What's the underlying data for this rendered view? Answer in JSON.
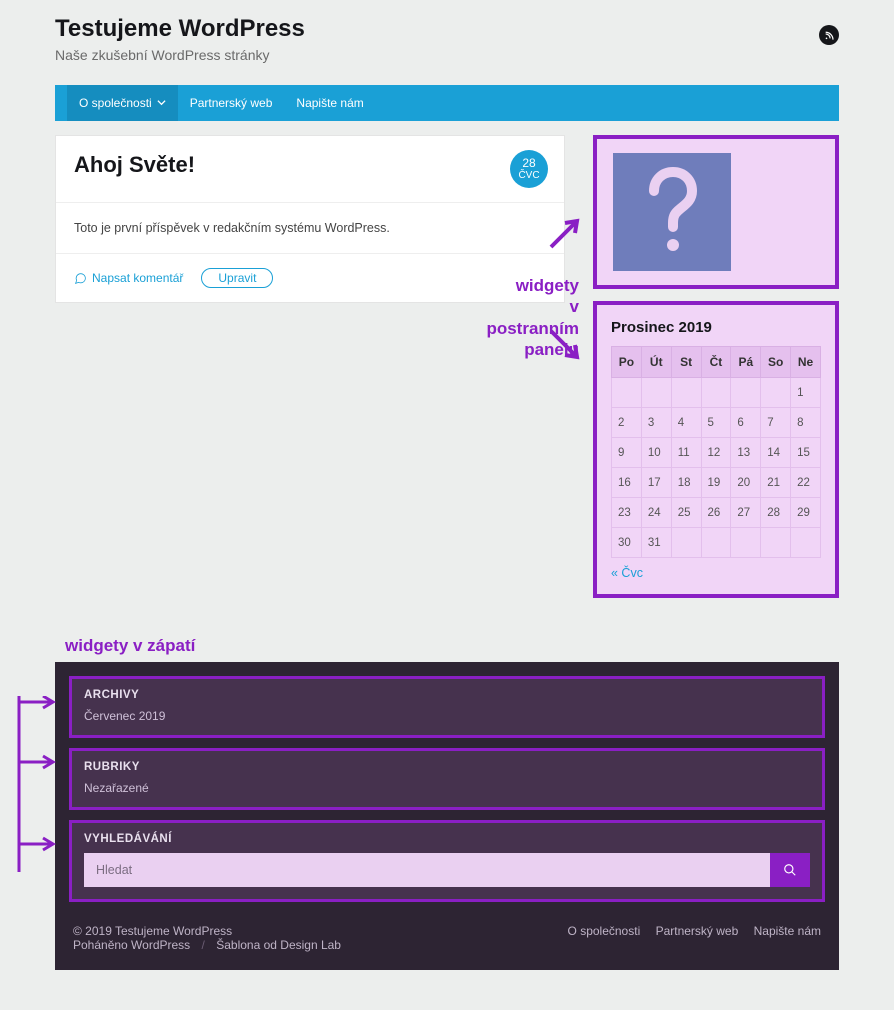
{
  "site": {
    "title": "Testujeme WordPress",
    "tagline": "Naše zkušební WordPress stránky"
  },
  "nav": [
    {
      "label": "O společnosti",
      "dropdown": true
    },
    {
      "label": "Partnerský web",
      "dropdown": false
    },
    {
      "label": "Napište nám",
      "dropdown": false
    }
  ],
  "post": {
    "title": "Ahoj Světe!",
    "date_day": "28",
    "date_month": "ČVC",
    "body": "Toto je první příspěvek v redakčním systému WordPress.",
    "comment_label": "Napsat komentář",
    "edit_label": "Upravit"
  },
  "annotation_sidebar_line1": "widgety",
  "annotation_sidebar_line2": "v postranním",
  "annotation_sidebar_line3": "panelu",
  "annotation_footer": "widgety v zápatí",
  "calendar": {
    "title": "Prosinec 2019",
    "days": [
      "Po",
      "Út",
      "St",
      "Čt",
      "Pá",
      "So",
      "Ne"
    ],
    "weeks": [
      [
        "",
        "",
        "",
        "",
        "",
        "",
        "1"
      ],
      [
        "2",
        "3",
        "4",
        "5",
        "6",
        "7",
        "8"
      ],
      [
        "9",
        "10",
        "11",
        "12",
        "13",
        "14",
        "15"
      ],
      [
        "16",
        "17",
        "18",
        "19",
        "20",
        "21",
        "22"
      ],
      [
        "23",
        "24",
        "25",
        "26",
        "27",
        "28",
        "29"
      ],
      [
        "30",
        "31",
        "",
        "",
        "",
        "",
        ""
      ]
    ],
    "prev": "« Čvc"
  },
  "footer": {
    "archives_title": "ARCHIVY",
    "archives_item": "Červenec 2019",
    "categories_title": "RUBRIKY",
    "categories_item": "Nezařazené",
    "search_title": "VYHLEDÁVÁNÍ",
    "search_placeholder": "Hledat"
  },
  "credits": {
    "copyright": "© 2019 Testujeme WordPress",
    "powered": "Poháněno WordPress",
    "theme": "Šablona od Design Lab",
    "links": [
      "O společnosti",
      "Partnerský web",
      "Napište nám"
    ]
  }
}
